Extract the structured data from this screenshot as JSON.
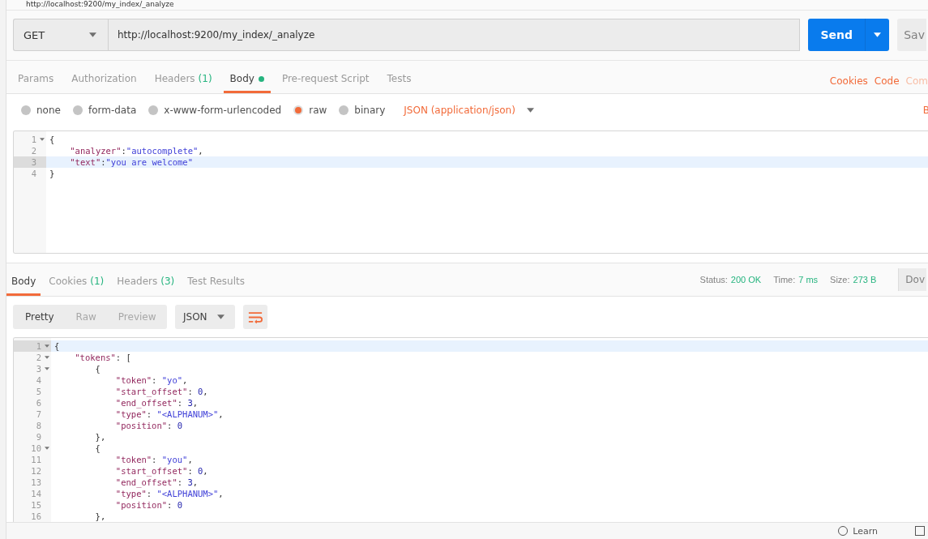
{
  "request_title": "http://localhost:9200/my_index/_analyze",
  "request": {
    "method": "GET",
    "url": "http://localhost:9200/my_index/_analyze",
    "send": "Send",
    "save": "Sav"
  },
  "request_tabs": [
    {
      "label": "Params",
      "selected": false
    },
    {
      "label": "Authorization",
      "selected": false
    },
    {
      "label": "Headers",
      "count": "(1)",
      "selected": false
    },
    {
      "label": "Body",
      "dot": true,
      "selected": true
    },
    {
      "label": "Pre-request Script",
      "selected": false
    },
    {
      "label": "Tests",
      "selected": false
    }
  ],
  "request_links": [
    {
      "label": "Cookies",
      "disabled": false
    },
    {
      "label": "Code",
      "disabled": false
    },
    {
      "label": "Com",
      "disabled": true
    }
  ],
  "body_types": [
    {
      "label": "none",
      "selected": false
    },
    {
      "label": "form-data",
      "selected": false
    },
    {
      "label": "x-www-form-urlencoded",
      "selected": false
    },
    {
      "label": "raw",
      "selected": true
    },
    {
      "label": "binary",
      "selected": false
    }
  ],
  "content_type": "JSON (application/json)",
  "beautify_cut": "B",
  "request_code": [
    {
      "number": "1",
      "fold": true,
      "active": false,
      "tokens": [
        {
          "kind": "punct",
          "text": "{"
        }
      ]
    },
    {
      "number": "2",
      "fold": false,
      "active": false,
      "tokens": [
        {
          "kind": "key",
          "text": "    \"analyzer\""
        },
        {
          "kind": "punct",
          "text": ":"
        },
        {
          "kind": "string",
          "text": "\"autocomplete\""
        },
        {
          "kind": "punct",
          "text": ","
        }
      ]
    },
    {
      "number": "3",
      "fold": false,
      "active": true,
      "tokens": [
        {
          "kind": "key",
          "text": "    \"text\""
        },
        {
          "kind": "punct",
          "text": ":"
        },
        {
          "kind": "string",
          "text": "\"you are welcome\""
        }
      ]
    },
    {
      "number": "4",
      "fold": false,
      "active": false,
      "tokens": [
        {
          "kind": "punct",
          "text": "}"
        }
      ]
    }
  ],
  "response_tabs": [
    {
      "label": "Body",
      "selected": true
    },
    {
      "label": "Cookies",
      "count": "(1)",
      "selected": false
    },
    {
      "label": "Headers",
      "count": "(3)",
      "selected": false
    },
    {
      "label": "Test Results",
      "selected": false
    }
  ],
  "response_meta": [
    {
      "label": "Status:",
      "value": "200 OK"
    },
    {
      "label": "Time:",
      "value": "7 ms"
    },
    {
      "label": "Size:",
      "value": "273 B"
    }
  ],
  "download_cut": "Dov",
  "view_modes": [
    {
      "label": "Pretty",
      "selected": true
    },
    {
      "label": "Raw",
      "selected": false
    },
    {
      "label": "Preview",
      "selected": false
    }
  ],
  "format": "JSON",
  "response_code": [
    {
      "number": "1",
      "fold": true,
      "active": true,
      "tokens": [
        {
          "kind": "punct",
          "text": "{"
        }
      ]
    },
    {
      "number": "2",
      "fold": true,
      "active": false,
      "tokens": [
        {
          "kind": "key",
          "text": "    \"tokens\""
        },
        {
          "kind": "punct",
          "text": ": ["
        }
      ]
    },
    {
      "number": "3",
      "fold": true,
      "active": false,
      "tokens": [
        {
          "kind": "punct",
          "text": "        {"
        }
      ]
    },
    {
      "number": "4",
      "fold": false,
      "active": false,
      "tokens": [
        {
          "kind": "key",
          "text": "            \"token\""
        },
        {
          "kind": "punct",
          "text": ": "
        },
        {
          "kind": "string",
          "text": "\"yo\""
        },
        {
          "kind": "punct",
          "text": ","
        }
      ]
    },
    {
      "number": "5",
      "fold": false,
      "active": false,
      "tokens": [
        {
          "kind": "key",
          "text": "            \"start_offset\""
        },
        {
          "kind": "punct",
          "text": ": "
        },
        {
          "kind": "number",
          "text": "0"
        },
        {
          "kind": "punct",
          "text": ","
        }
      ]
    },
    {
      "number": "6",
      "fold": false,
      "active": false,
      "tokens": [
        {
          "kind": "key",
          "text": "            \"end_offset\""
        },
        {
          "kind": "punct",
          "text": ": "
        },
        {
          "kind": "number",
          "text": "3"
        },
        {
          "kind": "punct",
          "text": ","
        }
      ]
    },
    {
      "number": "7",
      "fold": false,
      "active": false,
      "tokens": [
        {
          "kind": "key",
          "text": "            \"type\""
        },
        {
          "kind": "punct",
          "text": ": "
        },
        {
          "kind": "string",
          "text": "\"<ALPHANUM>\""
        },
        {
          "kind": "punct",
          "text": ","
        }
      ]
    },
    {
      "number": "8",
      "fold": false,
      "active": false,
      "tokens": [
        {
          "kind": "key",
          "text": "            \"position\""
        },
        {
          "kind": "punct",
          "text": ": "
        },
        {
          "kind": "number",
          "text": "0"
        }
      ]
    },
    {
      "number": "9",
      "fold": false,
      "active": false,
      "tokens": [
        {
          "kind": "punct",
          "text": "        },"
        }
      ]
    },
    {
      "number": "10",
      "fold": true,
      "active": false,
      "tokens": [
        {
          "kind": "punct",
          "text": "        {"
        }
      ]
    },
    {
      "number": "11",
      "fold": false,
      "active": false,
      "tokens": [
        {
          "kind": "key",
          "text": "            \"token\""
        },
        {
          "kind": "punct",
          "text": ": "
        },
        {
          "kind": "string",
          "text": "\"you\""
        },
        {
          "kind": "punct",
          "text": ","
        }
      ]
    },
    {
      "number": "12",
      "fold": false,
      "active": false,
      "tokens": [
        {
          "kind": "key",
          "text": "            \"start_offset\""
        },
        {
          "kind": "punct",
          "text": ": "
        },
        {
          "kind": "number",
          "text": "0"
        },
        {
          "kind": "punct",
          "text": ","
        }
      ]
    },
    {
      "number": "13",
      "fold": false,
      "active": false,
      "tokens": [
        {
          "kind": "key",
          "text": "            \"end_offset\""
        },
        {
          "kind": "punct",
          "text": ": "
        },
        {
          "kind": "number",
          "text": "3"
        },
        {
          "kind": "punct",
          "text": ","
        }
      ]
    },
    {
      "number": "14",
      "fold": false,
      "active": false,
      "tokens": [
        {
          "kind": "key",
          "text": "            \"type\""
        },
        {
          "kind": "punct",
          "text": ": "
        },
        {
          "kind": "string",
          "text": "\"<ALPHANUM>\""
        },
        {
          "kind": "punct",
          "text": ","
        }
      ]
    },
    {
      "number": "15",
      "fold": false,
      "active": false,
      "tokens": [
        {
          "kind": "key",
          "text": "            \"position\""
        },
        {
          "kind": "punct",
          "text": ": "
        },
        {
          "kind": "number",
          "text": "0"
        }
      ]
    },
    {
      "number": "16",
      "fold": false,
      "active": false,
      "tokens": [
        {
          "kind": "punct",
          "text": "        },"
        }
      ]
    }
  ],
  "footer": {
    "learn": "Learn"
  }
}
